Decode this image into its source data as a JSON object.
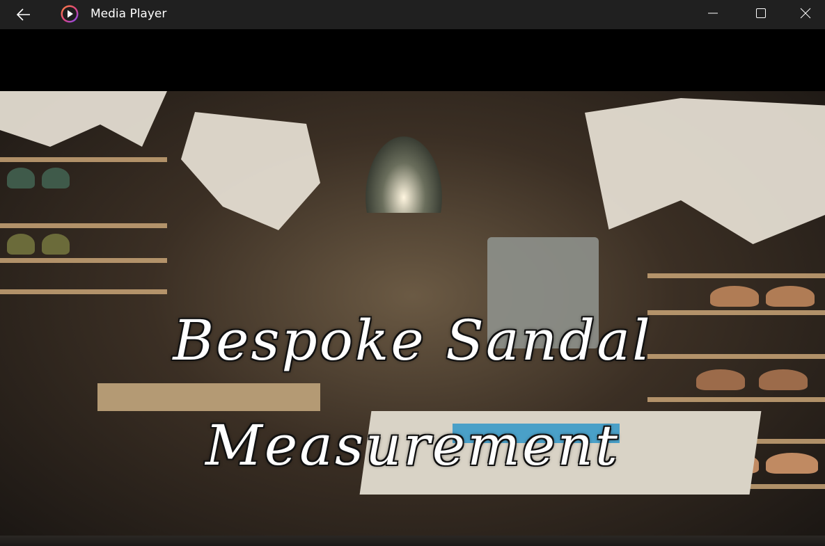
{
  "window": {
    "title": "Media Player",
    "back_icon": "arrow-left-icon",
    "app_icon": "media-player-logo",
    "controls": [
      "minimize-icon",
      "maximize-icon",
      "close-icon"
    ]
  },
  "video": {
    "caption_line1": "Bespoke Sandal",
    "caption_line2": "Measurement"
  },
  "colors": {
    "titlebar": "#202020",
    "background": "#000000",
    "caption_text": "#ffffff"
  }
}
